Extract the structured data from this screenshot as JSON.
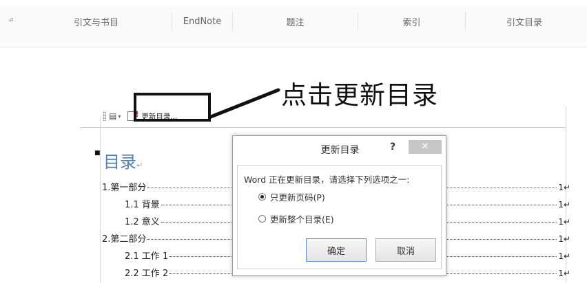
{
  "ribbon": {
    "launcher_icon": "dialog-launcher-icon",
    "groups": [
      "引文与书目",
      "EndNote",
      "题注",
      "索引",
      "引文目录"
    ]
  },
  "callout": {
    "text": "点击更新目录"
  },
  "toc_toolbar": {
    "doc_icon": "document-icon",
    "caret": "▾",
    "update_label": "更新目录..."
  },
  "document": {
    "toc_title": "目录",
    "paragraph_mark": "↵",
    "entries": [
      {
        "label": "1.第一部分",
        "page": "1↵"
      },
      {
        "label": "1.1 背景",
        "page": "1↵"
      },
      {
        "label": "1.2 意义",
        "page": "1↵"
      },
      {
        "label": "2.第二部分",
        "page": "1↵"
      },
      {
        "label": "2.1 工作 1",
        "page": "1↵"
      },
      {
        "label": "2.2 工作 2",
        "page": "1↵"
      }
    ]
  },
  "dialog": {
    "title": "更新目录",
    "help": "?",
    "close": "✕",
    "message": "Word 正在更新目录，请选择下列选项之一:",
    "options": [
      {
        "label": "只更新页码(P)",
        "checked": true
      },
      {
        "label": "更新整个目录(E)",
        "checked": false
      }
    ],
    "ok_label": "确定",
    "cancel_label": "取消"
  },
  "colors": {
    "toc_title": "#4a7fc0",
    "default_button_border": "#5b8fd0"
  }
}
